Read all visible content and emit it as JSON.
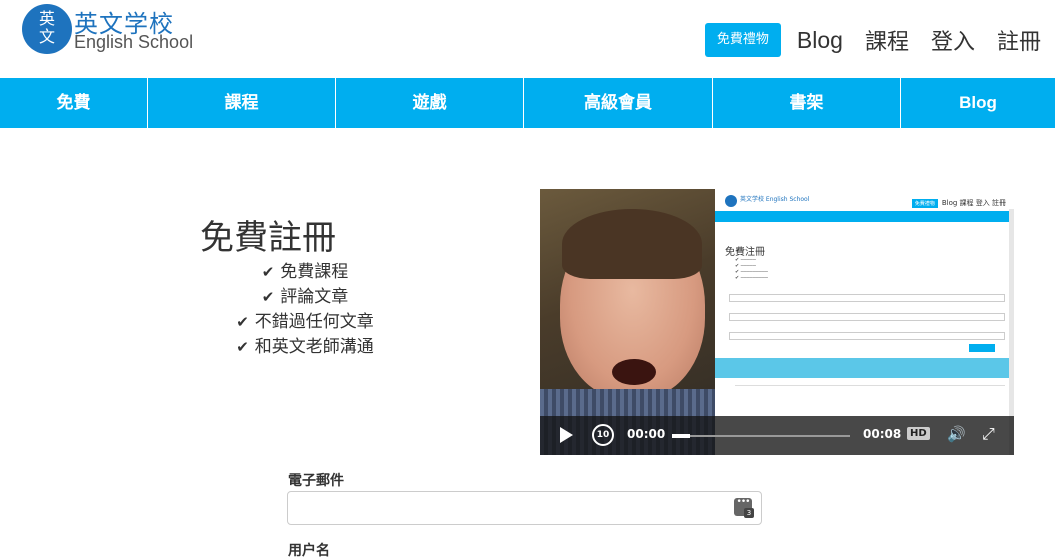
{
  "header": {
    "logo": {
      "circle_top": "英",
      "circle_bottom": "文",
      "title": "英文学校",
      "subtitle": "English School"
    },
    "gift_button": "免費禮物",
    "links": [
      "Blog",
      "課程",
      "登入",
      "註冊"
    ]
  },
  "main_nav": [
    "免費",
    "課程",
    "遊戲",
    "高級會員",
    "書架",
    "Blog"
  ],
  "signup": {
    "title": "免費註冊",
    "benefits": [
      "免費課程",
      "評論文章",
      "不錯過任何文章",
      "和英文老師溝通"
    ]
  },
  "video": {
    "current_time": "00:00",
    "total_time": "00:08",
    "progress": 0.1,
    "hd_label": "HD",
    "rewind_label": "10",
    "embedded_screen": {
      "logo_text": "英文学校 English School",
      "nav": "Blog  課程  登入  註冊",
      "gift": "免費禮物",
      "title": "免費注冊"
    }
  },
  "form": {
    "email_label": "電子郵件",
    "email_value": "",
    "email_badge": "3",
    "next_label": "用户名"
  },
  "colors": {
    "accent": "#00aeef",
    "brand": "#1e73be"
  }
}
